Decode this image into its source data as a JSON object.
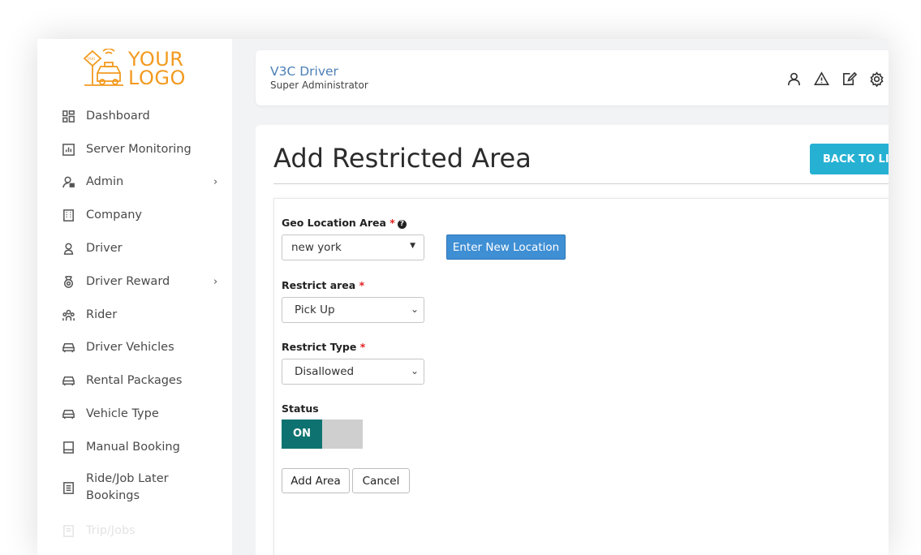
{
  "logo": {
    "text_line1": "YOUR",
    "text_line2": "LOGO",
    "badge": "TAXI",
    "color": "#f29a1f"
  },
  "sidebar": {
    "items": [
      {
        "label": "Dashboard",
        "icon": "dashboard-icon"
      },
      {
        "label": "Server Monitoring",
        "icon": "chart-icon"
      },
      {
        "label": "Admin",
        "icon": "admin-user-icon",
        "chevron": "›"
      },
      {
        "label": "Company",
        "icon": "building-icon"
      },
      {
        "label": "Driver",
        "icon": "user-icon"
      },
      {
        "label": "Driver Reward",
        "icon": "medal-icon",
        "chevron": "›"
      },
      {
        "label": "Rider",
        "icon": "people-icon"
      },
      {
        "label": "Driver Vehicles",
        "icon": "car-icon"
      },
      {
        "label": "Rental Packages",
        "icon": "car-icon"
      },
      {
        "label": "Vehicle Type",
        "icon": "car-icon"
      },
      {
        "label": "Manual Booking",
        "icon": "book-icon"
      },
      {
        "label": "Ride/Job Later",
        "label_line2": "Bookings",
        "icon": "list-icon"
      },
      {
        "label": "Trip/Jobs",
        "icon": "list-icon"
      }
    ]
  },
  "header": {
    "title": "V3C Driver",
    "subtitle": "Super Administrator",
    "icons": [
      "user-icon",
      "warning-icon",
      "edit-icon",
      "settings-icon"
    ]
  },
  "main": {
    "title": "Add Restricted Area",
    "back_button": "BACK TO LIST",
    "form": {
      "geo_label": "Geo Location Area",
      "geo_value": "new york",
      "enter_location_button": "Enter New Location",
      "restrict_area_label": "Restrict area",
      "restrict_area_value": "Pick Up",
      "restrict_type_label": "Restrict Type",
      "restrict_type_value": "Disallowed",
      "status_label": "Status",
      "status_toggle": "ON",
      "required_mark": "*",
      "help_mark": "?",
      "add_button": "Add Area",
      "cancel_button": "Cancel"
    }
  },
  "colors": {
    "accent": "#26b1d3",
    "primary_button": "#3f8fd4",
    "toggle_on": "#0e7370",
    "title_link": "#4a7fb5"
  }
}
